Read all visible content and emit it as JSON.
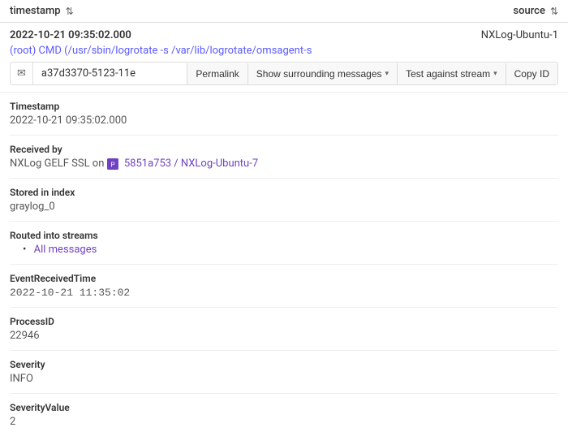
{
  "header": {
    "timestamp_label": "timestamp",
    "sort_icon": "⇅",
    "source_label": "source",
    "sort_icon2": "⇅"
  },
  "message": {
    "timestamp": "2022-10-21 09:35:02.000",
    "source": "NXLog-Ubuntu-1",
    "cmd": "(root) CMD (/usr/sbin/logrotate -s /var/lib/logrotate/omsagent-s",
    "id_truncated": "a37d3370-5123-11e",
    "buttons": {
      "permalink": "Permalink",
      "surrounding": "Show surrounding messages",
      "surrounding_caret": "▾",
      "test_stream": "Test against stream",
      "test_caret": "▾",
      "copy": "Copy ID"
    }
  },
  "details": {
    "timestamp_label": "Timestamp",
    "timestamp_value": "2022-10-21 09:35:02.000",
    "received_by_label": "Received by",
    "received_by_prefix": "NXLog GELF SSL on",
    "received_by_link": "5851a753 / NXLog-Ubuntu-7",
    "stored_label": "Stored in index",
    "stored_value": "graylog_0",
    "streams_label": "Routed into streams",
    "streams": [
      "All messages"
    ],
    "event_received_label": "EventReceivedTime",
    "event_received_value": "2022-10-21 11:35:02",
    "process_id_label": "ProcessID",
    "process_id_value": "22946",
    "severity_label": "Severity",
    "severity_value": "INFO",
    "severity_value_label": "SeverityValue",
    "severity_value_value": "2"
  }
}
